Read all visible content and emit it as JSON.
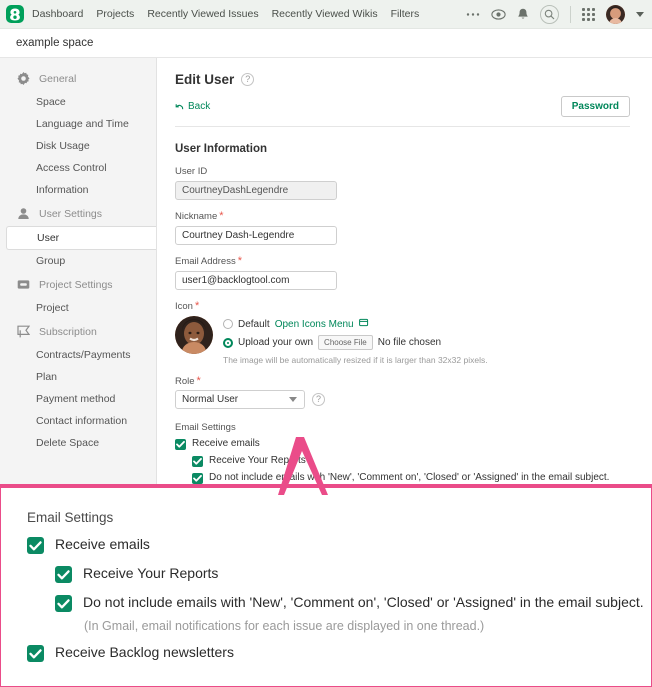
{
  "topbar": {
    "logo_icon": "backlog-logo-icon",
    "nav": [
      {
        "label": "Dashboard"
      },
      {
        "label": "Projects"
      },
      {
        "label": "Recently Viewed Issues"
      },
      {
        "label": "Recently Viewed Wikis"
      },
      {
        "label": "Filters"
      }
    ],
    "icons": {
      "more": "ellipsis-icon",
      "visibility": "eye-icon",
      "notifications": "bell-icon",
      "search": "search-icon",
      "apps": "grid-apps-icon",
      "avatar": "user-avatar",
      "caret": "chevron-down-icon"
    },
    "brand_green": "#00a05a",
    "bar_bg": "#eef2ee"
  },
  "space": {
    "name": "example space"
  },
  "sidebar": {
    "groups": [
      {
        "title": "General",
        "icon": "gear-icon",
        "items": [
          {
            "label": "Space",
            "active": false
          },
          {
            "label": "Language and Time",
            "active": false
          },
          {
            "label": "Disk Usage",
            "active": false
          },
          {
            "label": "Access Control",
            "active": false
          },
          {
            "label": "Information",
            "active": false
          }
        ]
      },
      {
        "title": "User Settings",
        "icon": "user-icon",
        "items": [
          {
            "label": "User",
            "active": true
          },
          {
            "label": "Group",
            "active": false
          }
        ]
      },
      {
        "title": "Project Settings",
        "icon": "inbox-icon",
        "items": [
          {
            "label": "Project",
            "active": false
          }
        ]
      },
      {
        "title": "Subscription",
        "icon": "ribbon-badge-icon",
        "items": [
          {
            "label": "Contracts/Payments",
            "active": false
          },
          {
            "label": "Plan",
            "active": false
          },
          {
            "label": "Payment method",
            "active": false
          },
          {
            "label": "Contact information",
            "active": false
          },
          {
            "label": "Delete Space",
            "active": false
          }
        ]
      }
    ]
  },
  "page": {
    "title": "Edit User",
    "help_icon": "question-mark-icon",
    "back_label": "Back",
    "back_icon": "back-arrow-icon",
    "password_button": "Password",
    "section_user_information": "User Information",
    "accent_green": "#00875a"
  },
  "form": {
    "user_id": {
      "label": "User ID",
      "value": "CourtneyDashLegendre",
      "required": false,
      "readonly": true
    },
    "nickname": {
      "label": "Nickname",
      "value": "Courtney Dash-Legendre",
      "required": true
    },
    "email": {
      "label": "Email Address",
      "value": "user1@backlogtool.com",
      "required": true
    },
    "icon": {
      "label": "Icon",
      "required": true,
      "avatar_name": "user-avatar-large",
      "option_default": "Default",
      "open_icons_menu": "Open Icons Menu",
      "open_icons_menu_icon": "external-window-icon",
      "option_upload": "Upload your own",
      "choose_file_button": "Choose File",
      "file_status": "No file chosen",
      "hint": "The image will be automatically resized if it is larger than 32x32 pixels.",
      "selected": "upload"
    },
    "role": {
      "label": "Role",
      "required": true,
      "value": "Normal User",
      "options": [
        "Normal User"
      ],
      "help_icon": "question-mark-icon"
    }
  },
  "email_settings": {
    "label": "Email Settings",
    "items": [
      {
        "label": "Receive emails",
        "checked": true,
        "indent": false
      },
      {
        "label": "Receive Your Reports",
        "checked": true,
        "indent": true
      },
      {
        "label": "Do not include emails with 'New', 'Comment on', 'Closed' or 'Assigned' in the email subject.",
        "checked": true,
        "indent": true
      },
      {
        "label": "Receive Backlog newsletters",
        "checked": true,
        "indent": false
      }
    ],
    "hint": "(In Gmail, email notifications for each issue are displayed in one thread.)",
    "checkbox_color": "#0b8a63"
  },
  "callout": {
    "border_color": "#ea4c89",
    "label": "Email Settings",
    "items": [
      {
        "label": "Receive emails",
        "checked": true,
        "indent": false
      },
      {
        "label": "Receive Your Reports",
        "checked": true,
        "indent": true
      },
      {
        "label": "Do not include emails with 'New', 'Comment on', 'Closed' or 'Assigned' in the email subject.",
        "checked": true,
        "indent": true
      },
      {
        "label": "Receive Backlog newsletters",
        "checked": true,
        "indent": false
      }
    ],
    "hint": "(In Gmail, email notifications for each issue are displayed in one thread.)"
  }
}
